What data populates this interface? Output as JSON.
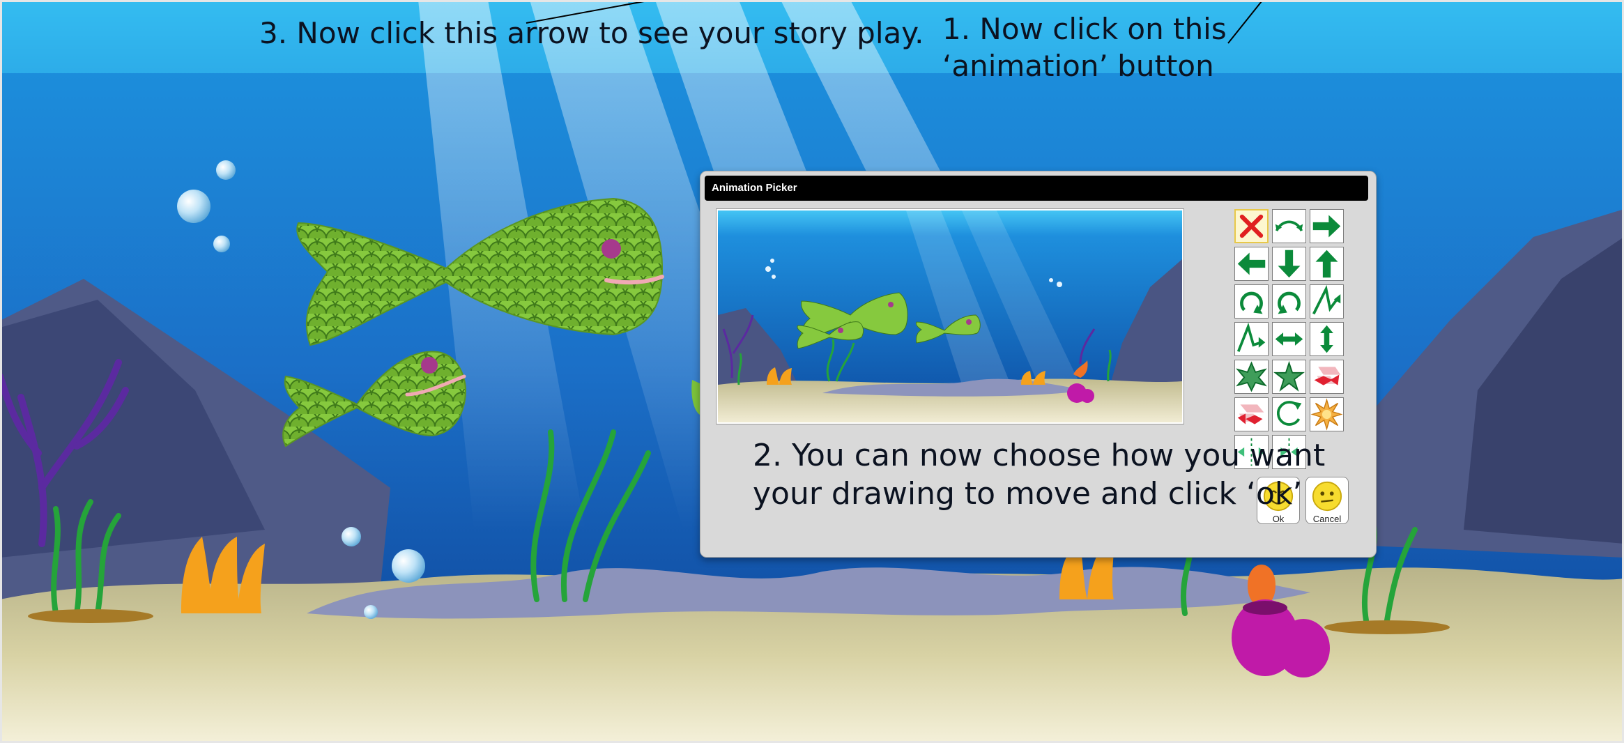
{
  "callouts": {
    "step1_line1": "1. Now click on this",
    "step1_line2": "‘animation’ button",
    "step2_line1": "2. You can now choose how you want",
    "step2_line2": "your drawing to move and click ‘ok’",
    "step3": "3. Now click this arrow to see your story play."
  },
  "dialog": {
    "title": "Animation Picker",
    "animations": [
      {
        "name": "none",
        "icon": "red-x-icon",
        "selected": true
      },
      {
        "name": "arc",
        "icon": "arc-arrow-icon"
      },
      {
        "name": "right",
        "icon": "arrow-right-icon"
      },
      {
        "name": "left",
        "icon": "arrow-left-icon"
      },
      {
        "name": "down",
        "icon": "arrow-down-icon"
      },
      {
        "name": "up",
        "icon": "arrow-up-icon"
      },
      {
        "name": "rotate-clockwise",
        "icon": "rotate-clockwise-icon"
      },
      {
        "name": "rotate-counterclockwise",
        "icon": "rotate-counterclockwise-icon"
      },
      {
        "name": "zigzag-right",
        "icon": "zigzag-right-icon"
      },
      {
        "name": "zigzag-left",
        "icon": "zigzag-left-icon"
      },
      {
        "name": "horizontal-bounce",
        "icon": "horizontal-bounce-icon"
      },
      {
        "name": "vertical-bounce",
        "icon": "vertical-bounce-icon"
      },
      {
        "name": "spin-star",
        "icon": "spin-star-icon"
      },
      {
        "name": "grow-star",
        "icon": "grow-star-icon"
      },
      {
        "name": "fly-in",
        "icon": "fly-in-icon"
      },
      {
        "name": "fly-out",
        "icon": "fly-out-icon"
      },
      {
        "name": "circle",
        "icon": "circle-arrow-icon"
      },
      {
        "name": "explode",
        "icon": "burst-icon"
      },
      {
        "name": "shake",
        "icon": "shake-icon"
      },
      {
        "name": "split",
        "icon": "split-icon"
      }
    ],
    "ok_label": "Ok",
    "cancel_label": "Cancel"
  },
  "colors": {
    "icon_green": "#0b8a3a",
    "fish_green": "#7cc23b",
    "fish_eye": "#a63a8c",
    "dialog_bg": "#d9d9d9"
  }
}
